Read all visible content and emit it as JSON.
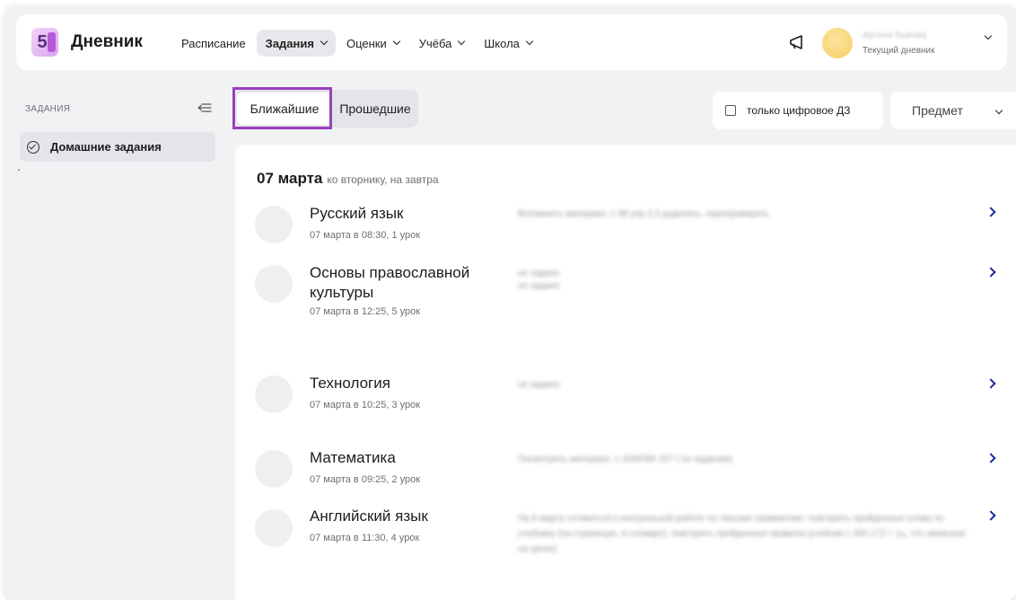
{
  "app": {
    "logo_number": "5",
    "brand": "Дневник"
  },
  "nav": {
    "items": [
      {
        "label": "Расписание"
      },
      {
        "label": "Задания"
      },
      {
        "label": "Оценки"
      },
      {
        "label": "Учёба"
      },
      {
        "label": "Школа"
      }
    ]
  },
  "user": {
    "name": "Арсеня Быкова",
    "subtitle": "Текущий дневник"
  },
  "sidebar": {
    "title": "ЗАДАНИЯ",
    "item": "Домашние задания"
  },
  "tabs": {
    "upcoming": "Ближайшие",
    "past": "Прошедшие"
  },
  "filters": {
    "digital_only": "только цифровое ДЗ",
    "subject": "Предмет"
  },
  "day": {
    "date": "07 марта",
    "subtitle": "ко вторнику, на завтра"
  },
  "lessons": [
    {
      "subject": "Русский язык",
      "meta": "07 марта в 08:30, 1 урок",
      "homework": "Вспомнить материал, с 98 упр 2,3 доделать, перепроверить"
    },
    {
      "subject": "Основы православной культуры",
      "meta": "07 марта в 12:25, 5 урок",
      "homework": "не задано\nне задано"
    },
    {
      "subject": "Технология",
      "meta": "07 марта в 10:25, 3 урок",
      "homework": "не задано"
    },
    {
      "subject": "Математика",
      "meta": "07 марта в 09:25, 2 урок",
      "homework": "Посмотреть материал, с 32МП06 107 ( по заданию)"
    },
    {
      "subject": "Английский язык",
      "meta": "07 марта в 11:30, 4 урок",
      "homework": "На 8 марта готовиться к контрольной работе по лексике грамматике: повторить пройденные слова по учебнику (на страницах, в словаре), повторить пройденные правила (учебник с 200 172 + 1ь, что записали на уроке)"
    }
  ]
}
